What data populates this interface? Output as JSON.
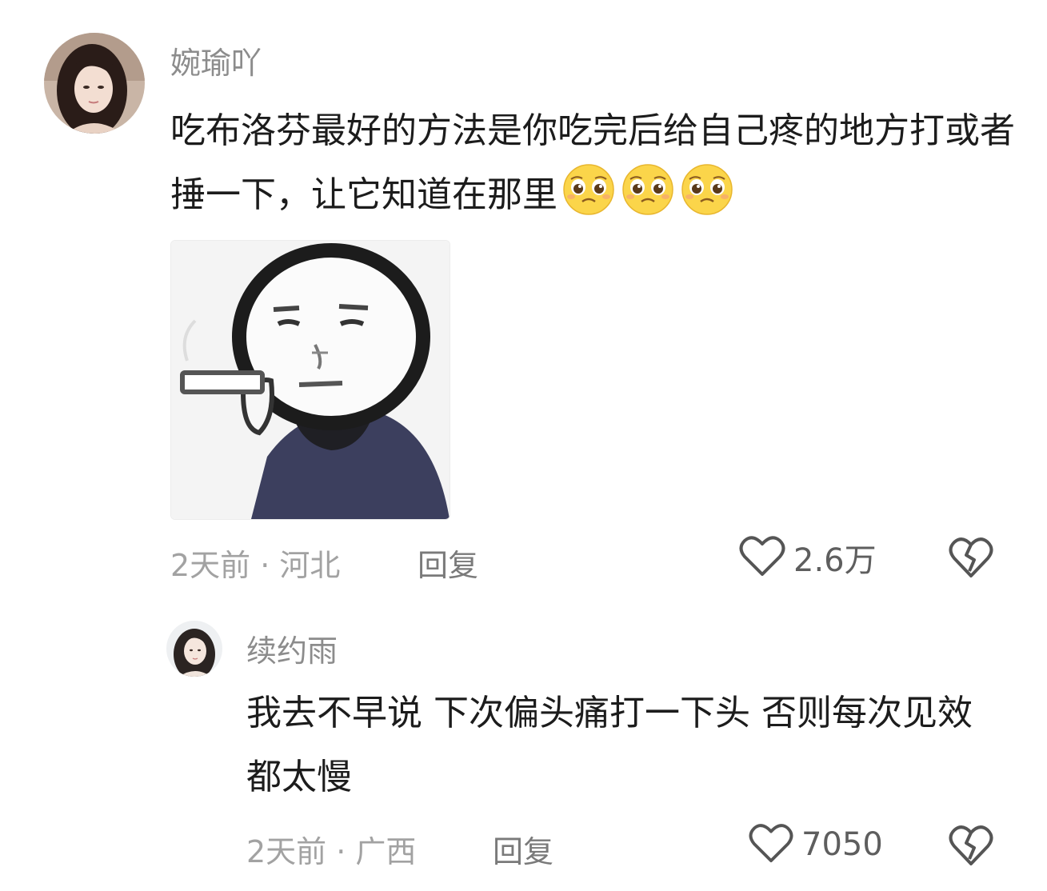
{
  "comments": [
    {
      "username": "婉瑜吖",
      "text": "吃布洛芬最好的方法是你吃完后给自己疼的地方打或者捶一下，让它知道在那里",
      "emojis": [
        "pleading-face-emoji",
        "pleading-face-emoji",
        "pleading-face-emoji"
      ],
      "sticker": "meme-sticker-smoking-man",
      "meta": "2天前 · 河北",
      "reply_label": "回复",
      "like_count": "2.6万"
    },
    {
      "username": "续约雨",
      "text": "我去不早说 下次偏头痛打一下头 否则每次见效都太慢",
      "meta": "2天前 · 广西",
      "reply_label": "回复",
      "like_count": "7050"
    }
  ],
  "icons": {
    "like": "heart-outline-icon",
    "dislike": "broken-heart-icon"
  },
  "colors": {
    "background": "#ffffff",
    "username": "#8c8c8c",
    "text": "#1c1c1c",
    "meta": "#a2a2a2"
  }
}
